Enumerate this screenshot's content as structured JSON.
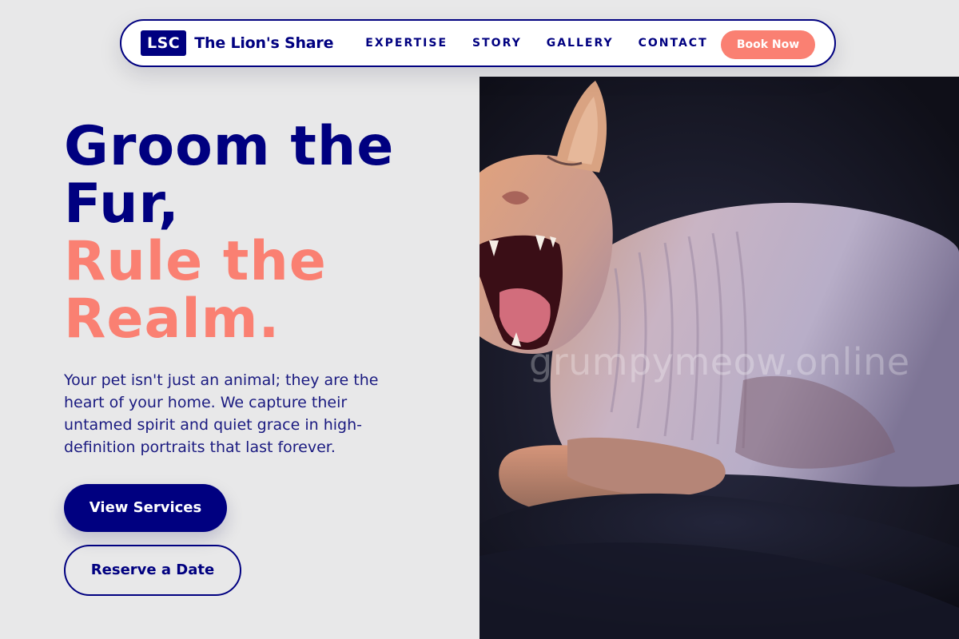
{
  "nav": {
    "logo_badge": "LSC",
    "brand_name": "The Lion's Share",
    "links": [
      {
        "label": "EXPERTISE"
      },
      {
        "label": "STORY"
      },
      {
        "label": "GALLERY"
      },
      {
        "label": "CONTACT"
      }
    ],
    "cta_label": "Book Now"
  },
  "hero": {
    "headline": {
      "line1": "Groom the",
      "line2": "Fur,",
      "line3": "Rule the",
      "line4": "Realm."
    },
    "description": "Your pet isn't just an animal; they are the heart of your home. We capture their untamed spirit and quiet grace in high-definition portraits that last forever.",
    "primary_button": "View Services",
    "secondary_button": "Reserve a Date",
    "image": {
      "subject": "hairless sphynx cat yawning",
      "watermark": "grumpymeow.online"
    }
  },
  "colors": {
    "navy": "#000080",
    "salmon": "#fa8072",
    "background": "#e8e8e9",
    "white": "#ffffff"
  }
}
